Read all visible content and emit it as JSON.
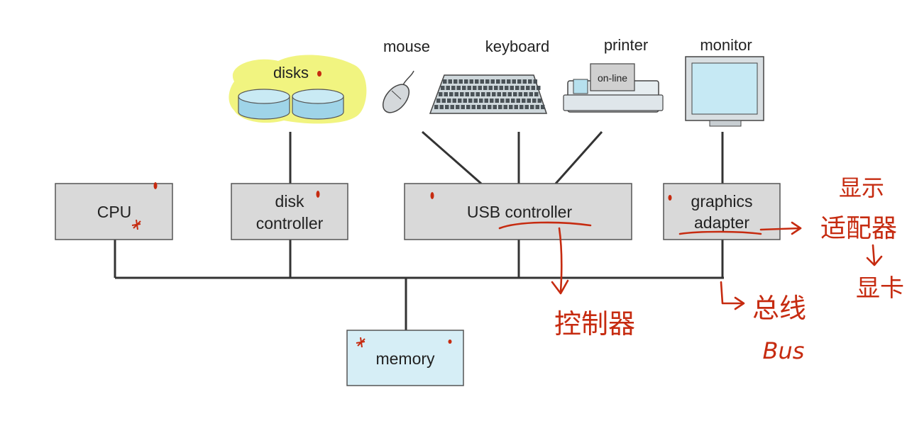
{
  "diagram": {
    "devices": {
      "disks": "disks",
      "mouse": "mouse",
      "keyboard": "keyboard",
      "printer": "printer",
      "printer_panel": "on-line",
      "monitor": "monitor"
    },
    "boxes": {
      "cpu": "CPU",
      "disk_controller_line1": "disk",
      "disk_controller_line2": "controller",
      "usb_controller": "USB controller",
      "graphics_adapter_line1": "graphics",
      "graphics_adapter_line2": "adapter",
      "memory": "memory"
    },
    "colors": {
      "box_fill": "#d9d9d9",
      "memory_fill": "#d6eef6",
      "line": "#333333",
      "highlight": "#eef26a",
      "annotation": "#c62b10"
    }
  },
  "annotations": {
    "controller_note": "控制器",
    "adapter_note_line1": "显示",
    "adapter_note_line2": "适配器",
    "adapter_note_line3": "显卡",
    "bus_note": "总线",
    "bus_english": "Bus"
  }
}
